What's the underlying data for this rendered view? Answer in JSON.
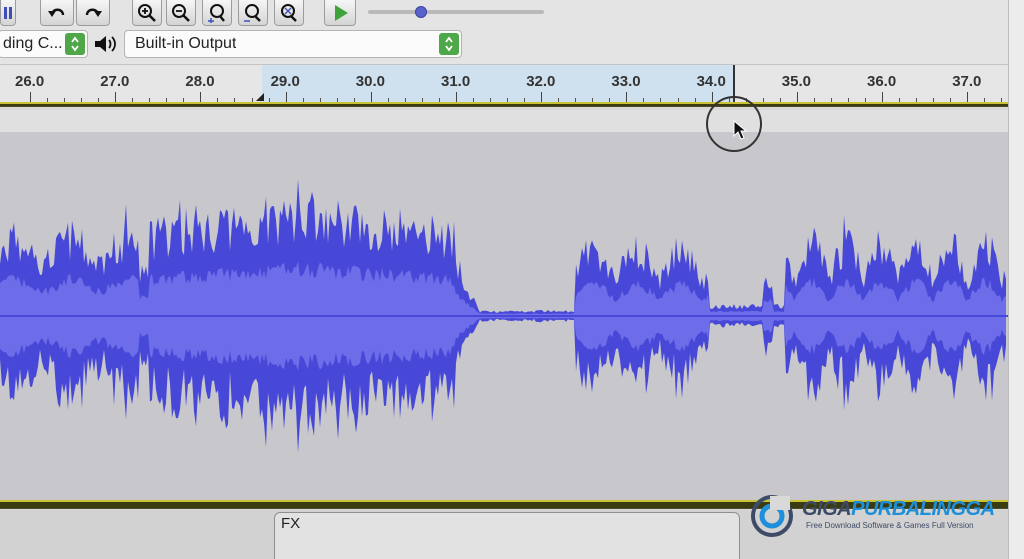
{
  "toolbar": {
    "buttons": [
      "undo-icon",
      "redo-icon",
      "zoom-in-icon",
      "zoom-out-icon",
      "fit-selection-icon",
      "fit-project-icon",
      "zoom-toggle-icon",
      "play-icon"
    ],
    "recording_device": "ding C...",
    "playback_device": "Built-in Output",
    "playback_speed_level": 0.3
  },
  "timeline": {
    "ticks": [
      "26.0",
      "27.0",
      "28.0",
      "29.0",
      "30.0",
      "31.0",
      "32.0",
      "33.0",
      "34.0",
      "35.0",
      "36.0",
      "37.0"
    ],
    "selection_start": "28.8",
    "selection_end": "34.1"
  },
  "track": {
    "effects_label": "FX",
    "waveform_color": "#4848d8",
    "waveform_background": "#c7c7cc"
  },
  "watermark": {
    "title_part1": "GIGA",
    "title_part2": "PURBALINGGA",
    "subtitle": "Free Download Software & Games Full Version"
  },
  "colors": {
    "accent_green": "#4ea748",
    "selection": "#cfe0ef"
  }
}
